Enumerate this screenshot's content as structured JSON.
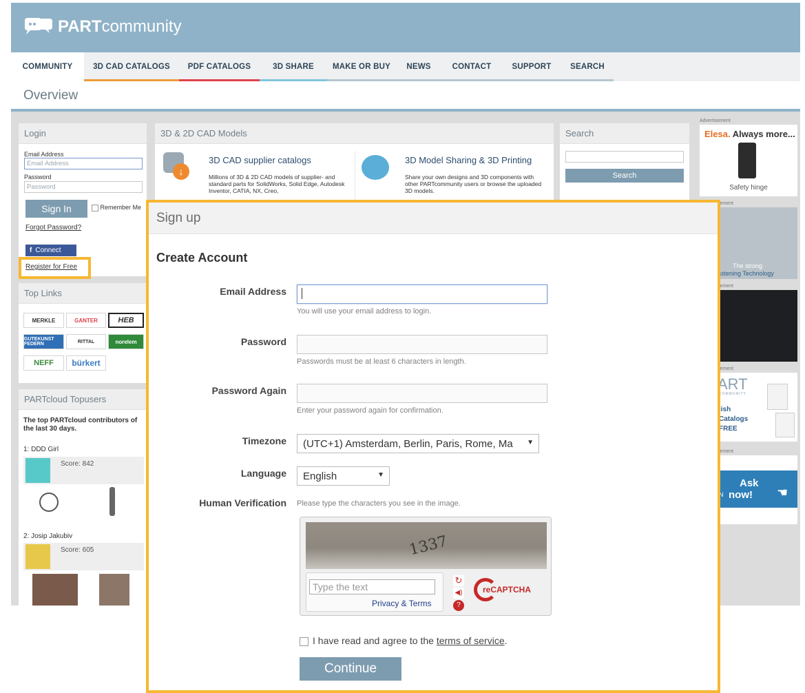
{
  "brand": {
    "bold": "PART",
    "light": "community"
  },
  "nav": [
    {
      "label": "COMMUNITY",
      "color": "#ffffff"
    },
    {
      "label": "3D CAD CATALOGS",
      "color": "#ec9b38"
    },
    {
      "label": "PDF CATALOGS",
      "color": "#e0424b"
    },
    {
      "label": "3D SHARE",
      "color": "#7fc6dd"
    },
    {
      "label": "MAKE OR BUY",
      "color": "#b6c6d0"
    },
    {
      "label": "NEWS",
      "color": "#b6c6d0"
    },
    {
      "label": "CONTACT",
      "color": "#b6c6d0"
    },
    {
      "label": "SUPPORT",
      "color": "#b6c6d0"
    },
    {
      "label": "SEARCH",
      "color": "#b6c6d0"
    }
  ],
  "page_title": "Overview",
  "login": {
    "title": "Login",
    "email_label": "Email Address",
    "email_placeholder": "Email Address",
    "password_label": "Password",
    "password_placeholder": "Password",
    "signin": "Sign In",
    "remember": "Remember Me",
    "forgot": "Forgot Password?",
    "connect": "Connect",
    "register": "Register for Free"
  },
  "models": {
    "title": "3D & 2D CAD Models",
    "cad_title": "3D CAD supplier catalogs",
    "cad_text": "Millions of 3D & 2D CAD models of supplier- and standard parts for SolidWorks, Solid Edge, Autodesk Inventor, CATIA, NX, Creo,",
    "share_title": "3D Model Sharing & 3D Printing",
    "share_text": "Share your own designs and 3D components with other PARTcommunity users or browse the uploaded 3D models."
  },
  "search": {
    "title": "Search",
    "button": "Search"
  },
  "top_links": {
    "title": "Top Links",
    "logos": [
      "MERKLE",
      "GANTER",
      "HEB",
      "GUTEKUNST FEDERN",
      "RITTAL",
      "norelem",
      "NEFF",
      "bürkert"
    ]
  },
  "topusers": {
    "title": "PARTcloud Topusers",
    "intro": "The top PARTcloud contributors of the last 30 days.",
    "users": [
      {
        "rank": "1: DDD Girl",
        "score": "Score: 842"
      },
      {
        "rank": "2: Josip Jakubiv",
        "score": "Score: 605"
      }
    ]
  },
  "ads": {
    "label": "Advertisement",
    "elesa_brand": "Elesa.",
    "elesa_tag": " Always more...",
    "elesa_caption": "Safety hinge",
    "strong_line1": "The strong",
    "strong_line2": "astening Technology",
    "part_text": "ART",
    "part_sub": "COMMUNITY",
    "part_lines": [
      "lish",
      "Catalogs",
      "FREE"
    ],
    "ask_line1": "Ask",
    "ask_line2": "now!",
    "ask_prefix": "N",
    "cut_label": "sement"
  },
  "signup": {
    "header": "Sign up",
    "heading": "Create Account",
    "email_label": "Email Address",
    "email_hint": "You will use your email address to login.",
    "password_label": "Password",
    "password_hint": "Passwords must be at least 6 characters in length.",
    "password2_label": "Password Again",
    "password2_hint": "Enter your password again for confirmation.",
    "timezone_label": "Timezone",
    "timezone_value": "(UTC+1) Amsterdam, Berlin, Paris, Rome, Ma",
    "language_label": "Language",
    "language_value": "English",
    "verification_label": "Human Verification",
    "verification_hint": "Please type the characters you see in the image.",
    "captcha_text": "1337",
    "captcha_placeholder": "Type the text",
    "captcha_link": "Privacy & Terms",
    "captcha_brand": "reCAPTCHA",
    "agree_prefix": "I have read and agree to the ",
    "agree_link": "terms of service",
    "agree_suffix": ".",
    "continue": "Continue"
  }
}
